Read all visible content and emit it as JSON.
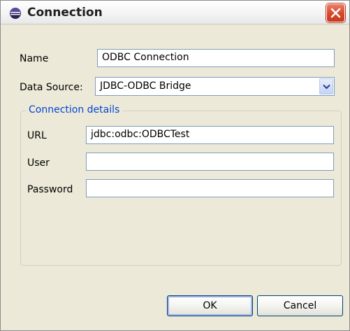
{
  "window": {
    "title": "Connection"
  },
  "form": {
    "name_label": "Name",
    "name_value": "ODBC Connection",
    "datasource_label": "Data Source:",
    "datasource_value": "JDBC-ODBC Bridge"
  },
  "connection_details": {
    "legend": "Connection details",
    "url_label": "URL",
    "url_value": "jdbc:odbc:ODBCTest",
    "user_label": "User",
    "user_value": "",
    "password_label": "Password",
    "password_value": ""
  },
  "buttons": {
    "ok": "OK",
    "cancel": "Cancel"
  },
  "icons": {
    "title": "eclipse-icon",
    "close": "close-icon",
    "dropdown": "chevron-down-icon"
  },
  "colors": {
    "legend": "#0046d5",
    "close": "#d7482a",
    "window_bg": "#ece9d8"
  }
}
